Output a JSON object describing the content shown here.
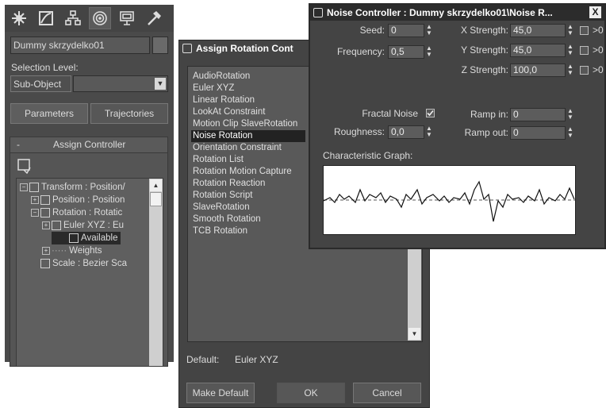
{
  "command_panel": {
    "object_name": "Dummy skrzydelko01",
    "selection_level_label": "Selection Level:",
    "sub_object": "Sub-Object",
    "tabs": {
      "parameters": "Parameters",
      "trajectories": "Trajectories"
    },
    "rollout_title": "Assign Controller",
    "rollout_minus": "-",
    "tree": [
      "Transform : Position/",
      "Position : Position",
      "Rotation : Rotatic",
      "Euler XYZ : Eu",
      "Available",
      "Weights",
      "Scale : Bezier Sca"
    ]
  },
  "assign_dialog": {
    "title": "Assign Rotation Cont",
    "items": [
      "AudioRotation",
      "Euler XYZ",
      "Linear Rotation",
      "LookAt Constraint",
      "Motion Clip SlaveRotation",
      "Noise Rotation",
      "Orientation Constraint",
      "Rotation List",
      "Rotation Motion Capture",
      "Rotation Reaction",
      "Rotation Script",
      "SlaveRotation",
      "Smooth Rotation",
      "TCB Rotation"
    ],
    "selected_item": "Noise Rotation",
    "default_label": "Default:",
    "default_value": "Euler XYZ",
    "make_default": "Make Default",
    "ok": "OK",
    "cancel": "Cancel"
  },
  "noise_controller": {
    "title": "Noise Controller : Dummy skrzydelko01\\Noise R...",
    "close": "X",
    "seed_label": "Seed:",
    "seed": "0",
    "frequency_label": "Frequency:",
    "frequency": "0,5",
    "x_strength_label": "X Strength:",
    "x_strength": "45,0",
    "y_strength_label": "Y Strength:",
    "y_strength": "45,0",
    "z_strength_label": "Z Strength:",
    "z_strength": "100,0",
    "gt_label": ">0",
    "fractal_label": "Fractal Noise",
    "roughness_label": "Roughness:",
    "roughness": "0,0",
    "ramp_in_label": "Ramp in:",
    "ramp_in": "0",
    "ramp_out_label": "Ramp out:",
    "ramp_out": "0",
    "graph_label": "Characteristic Graph:"
  }
}
